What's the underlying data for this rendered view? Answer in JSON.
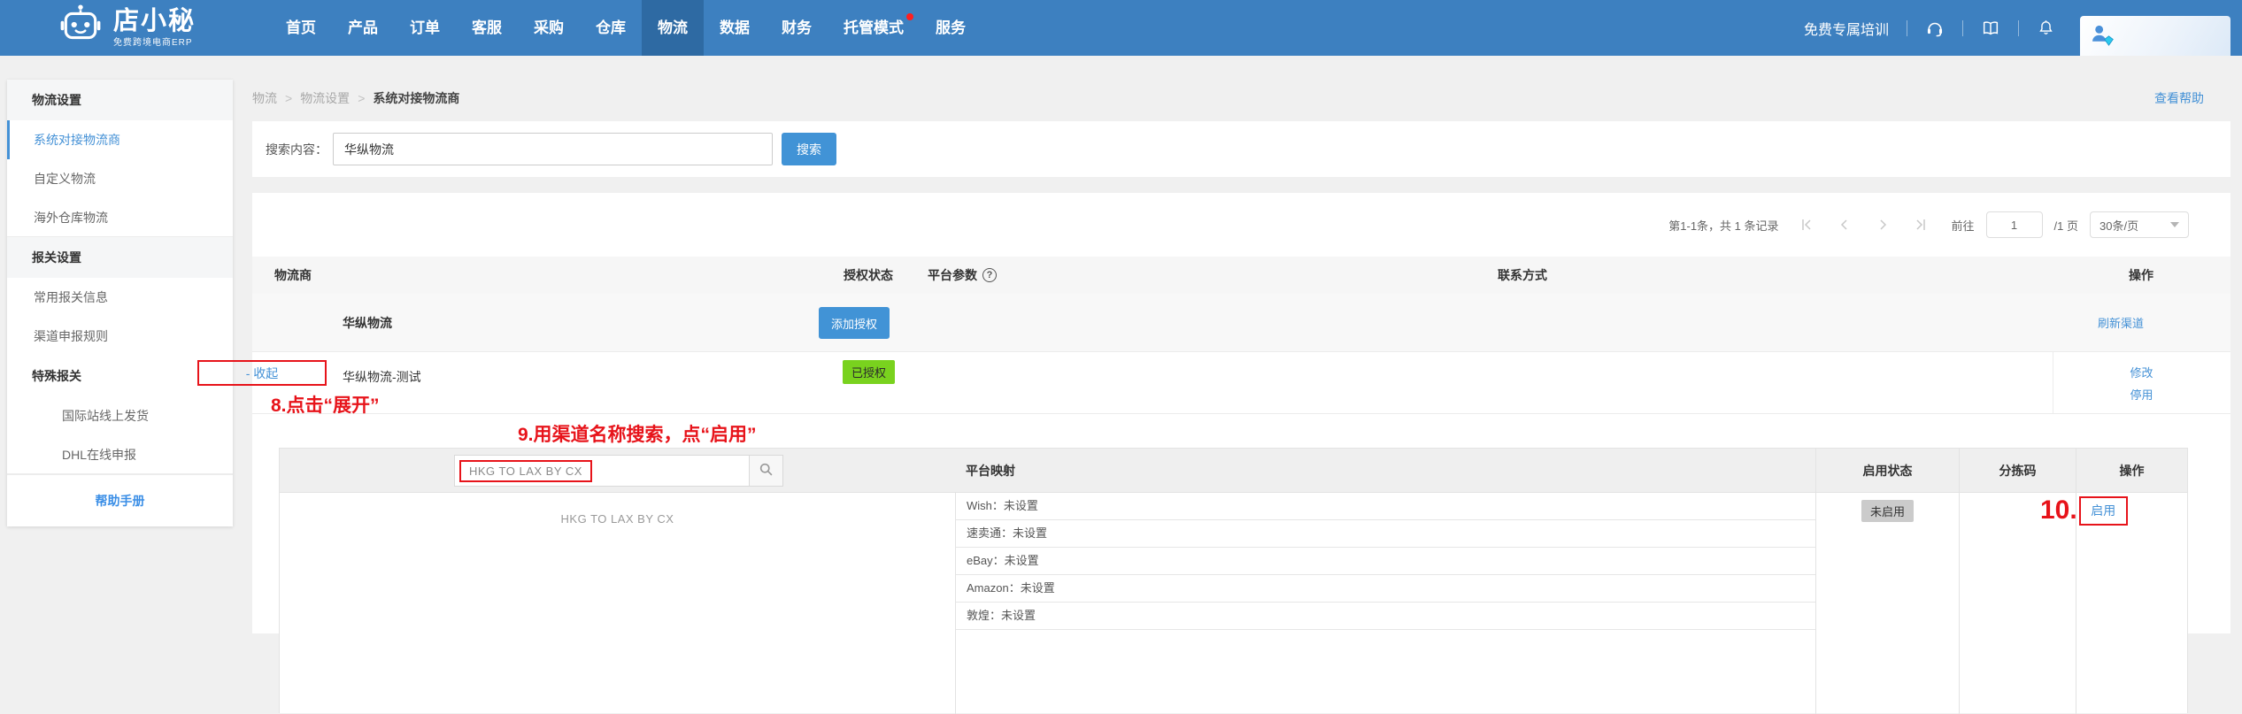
{
  "nav": {
    "brand": "店小秘",
    "tagline": "免费跨境电商ERP",
    "items": [
      "首页",
      "产品",
      "订单",
      "客服",
      "采购",
      "仓库",
      "物流",
      "数据",
      "财务",
      "托管模式",
      "服务"
    ],
    "right": {
      "training": "免费专属培训"
    }
  },
  "sidebar": {
    "items": [
      {
        "label": "物流设置",
        "type": "header"
      },
      {
        "label": "系统对接物流商",
        "type": "item",
        "active": true
      },
      {
        "label": "自定义物流",
        "type": "item"
      },
      {
        "label": "海外仓库物流",
        "type": "item"
      },
      {
        "label": "报关设置",
        "type": "header"
      },
      {
        "label": "常用报关信息",
        "type": "item"
      },
      {
        "label": "渠道申报规则",
        "type": "item"
      },
      {
        "label": "特殊报关",
        "type": "subheader"
      },
      {
        "label": "国际站线上发货",
        "type": "subitem"
      },
      {
        "label": "DHL在线申报",
        "type": "subitem"
      },
      {
        "label": "帮助手册",
        "type": "help"
      }
    ]
  },
  "breadcrumb": {
    "parts": [
      "物流",
      "物流设置",
      "系统对接物流商"
    ],
    "separator": ">"
  },
  "help_link": "查看帮助",
  "search": {
    "label": "搜索内容：",
    "value": "华纵物流",
    "button": "搜索"
  },
  "pagination": {
    "summary": "第1-1条，共 1 条记录",
    "goto_label": "前往",
    "page_value": "1",
    "total_label": "/1 页",
    "page_size": "30条/页"
  },
  "table": {
    "headers": [
      "物流商",
      "授权状态",
      "平台参数",
      "联系方式",
      "操作"
    ],
    "help_icon": "?",
    "provider_row": {
      "name": "华纵物流",
      "auth_button": "添加授权",
      "refresh_link": "刷新渠道"
    },
    "channel_row": {
      "collapse": "- 收起",
      "name": "华纵物流-测试",
      "status": "已授权",
      "modify": "修改",
      "disable": "停用"
    }
  },
  "annotations": {
    "step8": "8.点击“展开”",
    "step9": "9.用渠道名称搜索，点“启用”",
    "step10": "10."
  },
  "inner_table": {
    "search_value": "HKG TO LAX BY CX",
    "headers": {
      "mapping": "平台映射",
      "status": "启用状态",
      "sort_code": "分拣码",
      "action": "操作"
    },
    "row": {
      "channel": "HKG TO LAX BY CX",
      "mappings": [
        "Wish：未设置",
        "速卖通：未设置",
        "eBay：未设置",
        "Amazon：未设置",
        "敦煌：未设置"
      ],
      "status": "未启用",
      "action": "启用"
    }
  }
}
